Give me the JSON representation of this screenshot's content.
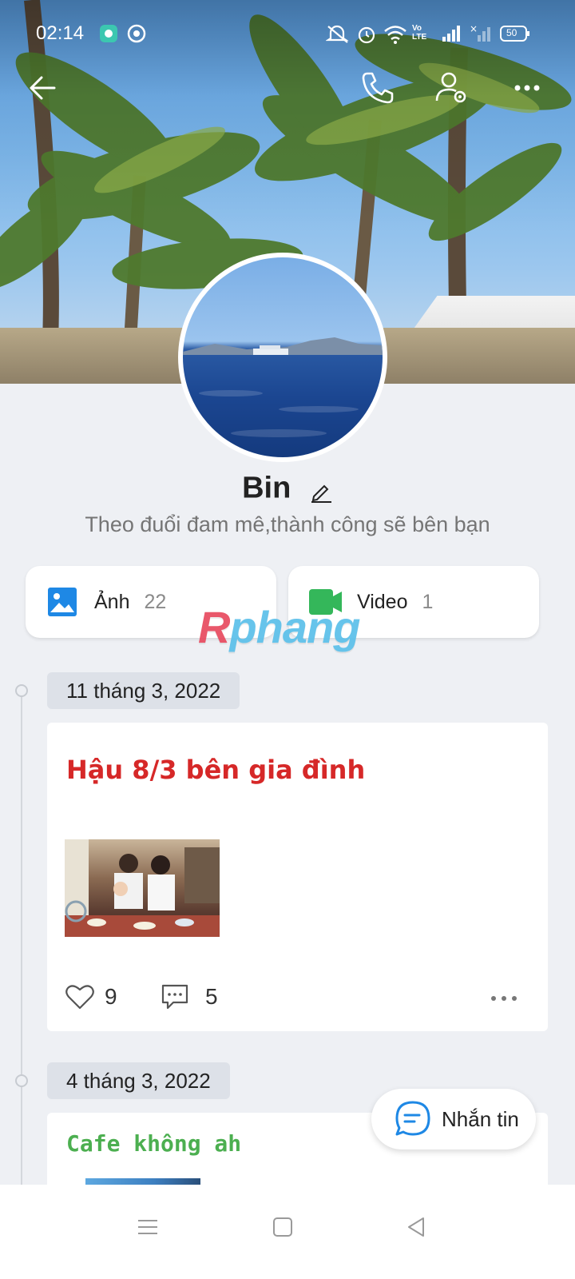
{
  "status_bar": {
    "time": "02:14",
    "battery": "50",
    "icons": [
      "app-icon",
      "ball-icon",
      "silent-icon",
      "alarm-icon",
      "wifi-icon",
      "volte-icon",
      "signal-icon",
      "signal-x-icon",
      "battery-icon"
    ]
  },
  "top_nav": {
    "icons": [
      "back-arrow-icon",
      "phone-icon",
      "user-settings-icon",
      "more-icon"
    ]
  },
  "profile": {
    "name": "Bin",
    "bio": "Theo đuổi đam mê,thành công sẽ bên bạn"
  },
  "media": {
    "photos_label": "Ảnh",
    "photos_count": "22",
    "videos_label": "Video",
    "videos_count": "1"
  },
  "watermark": {
    "first": "R",
    "rest": "phang"
  },
  "timeline": [
    {
      "date": "11 tháng 3, 2022",
      "title": "Hậu 8/3 bên gia đình",
      "likes": "9",
      "comments": "5"
    },
    {
      "date": "4 tháng 3, 2022",
      "title": "Cafe không ah"
    }
  ],
  "fab": {
    "label": "Nhắn tin"
  },
  "colors": {
    "accent_blue": "#1e88e5",
    "post_title_red": "#d62828",
    "post_title_green": "#4caf50",
    "video_green": "#34b75a"
  }
}
